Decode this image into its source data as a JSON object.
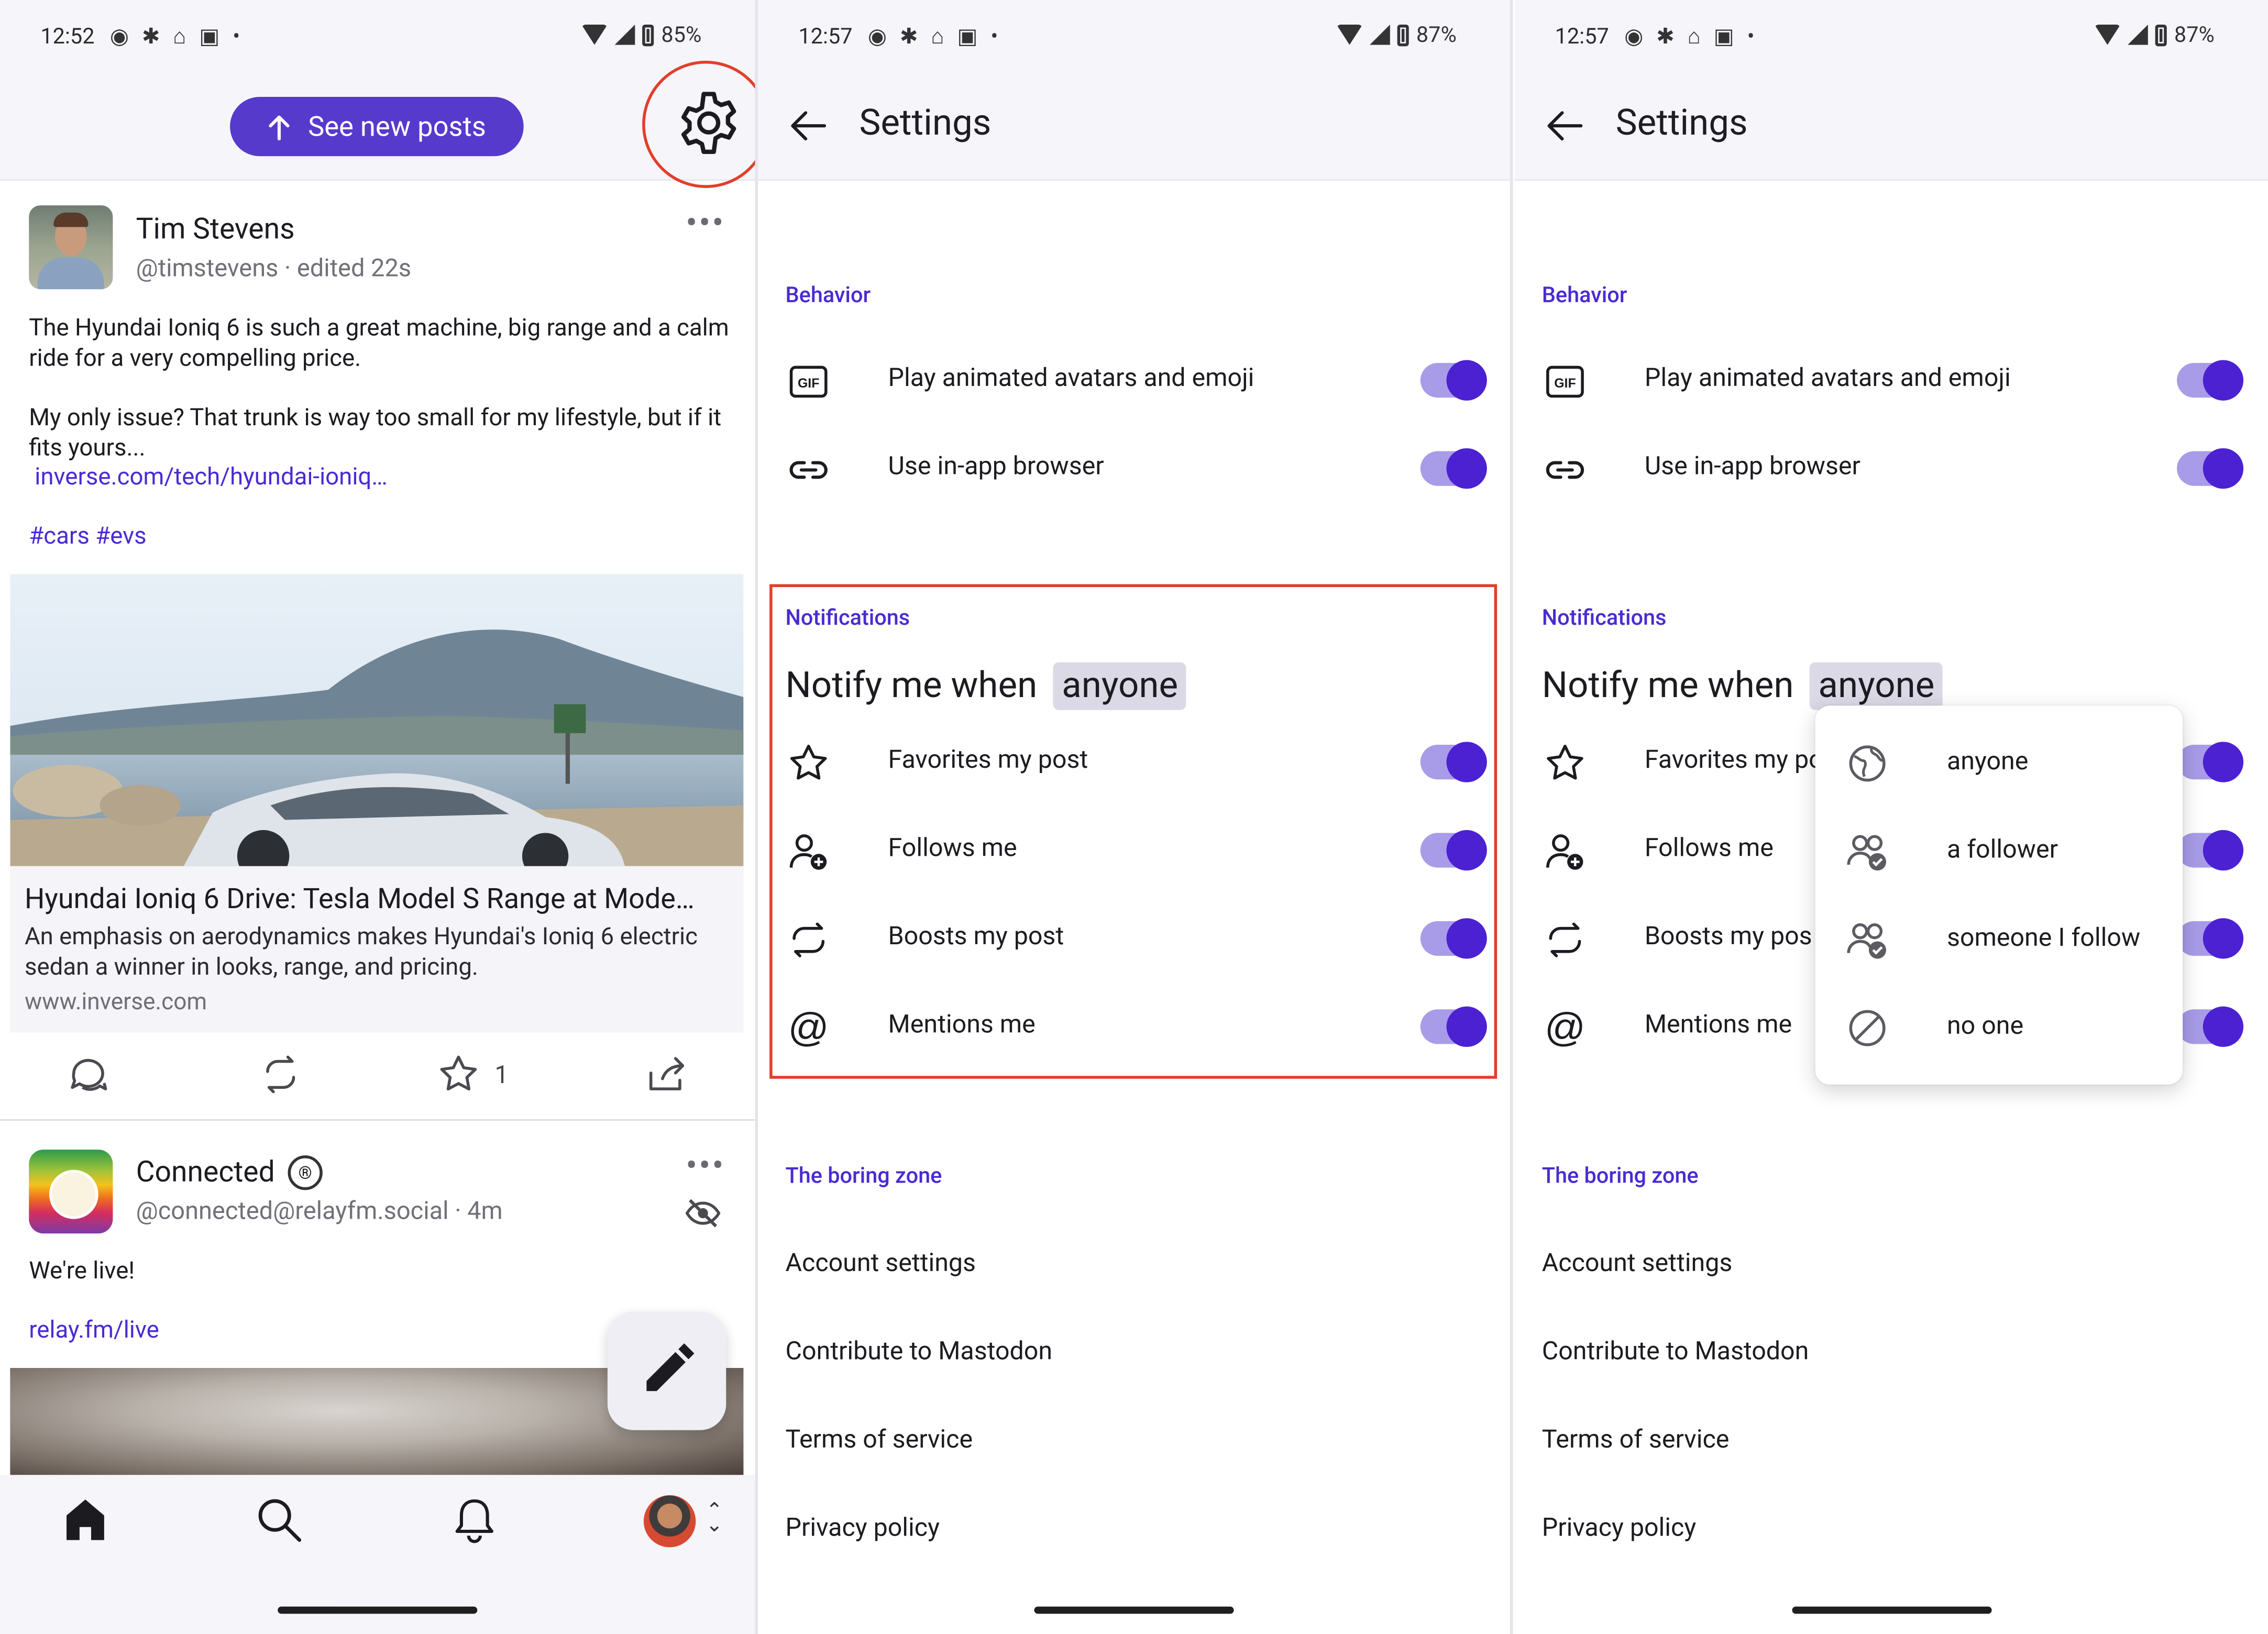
{
  "status_bars": [
    {
      "time": "12:52",
      "battery": "85%"
    },
    {
      "time": "12:57",
      "battery": "87%"
    },
    {
      "time": "12:57",
      "battery": "87%"
    }
  ],
  "feed": {
    "see_new_posts": "See new posts",
    "post1": {
      "author": "Tim Stevens",
      "handle": "@timstevens · edited 22s",
      "text1": "The Hyundai Ioniq 6 is such a great machine, big range and a calm ride for a very compelling price.",
      "text2": "My only issue? That trunk is way too small for my lifestyle, but if it fits yours...",
      "link": "inverse.com/tech/hyundai-ioniq…",
      "tags": "#cars #evs",
      "card_title": "Hyundai Ioniq 6 Drive: Tesla Model S Range at Mode…",
      "card_desc": "An emphasis on aerodynamics makes Hyundai's Ioniq 6 electric sedan a winner in looks, range, and pricing.",
      "card_domain": "www.inverse.com",
      "favorite_count": "1"
    },
    "post2": {
      "author": "Connected",
      "badge": "®",
      "handle": "@connected@relayfm.social · 4m",
      "text": "We're live!",
      "link": "relay.fm/live"
    }
  },
  "settings": {
    "title": "Settings",
    "behavior_label": "Behavior",
    "behavior_items": [
      "Play animated avatars and emoji",
      "Use in-app browser"
    ],
    "notifications_label": "Notifications",
    "notify_prefix": "Notify me when",
    "notify_value": "anyone",
    "notification_items": [
      "Favorites my post",
      "Follows me",
      "Boosts my post",
      "Mentions me"
    ],
    "notification_items_truncated": [
      "Favorites my po",
      "Follows me",
      "Boosts my pos",
      "Mentions me"
    ],
    "boring_label": "The boring zone",
    "boring_items": [
      "Account settings",
      "Contribute to Mastodon",
      "Terms of service",
      "Privacy policy"
    ]
  },
  "dropdown": {
    "options": [
      "anyone",
      "a follower",
      "someone I follow",
      "no one"
    ]
  },
  "colors": {
    "accent": "#563acc",
    "toggle_on": "#4b21d2",
    "highlight": "#e23e2b"
  }
}
